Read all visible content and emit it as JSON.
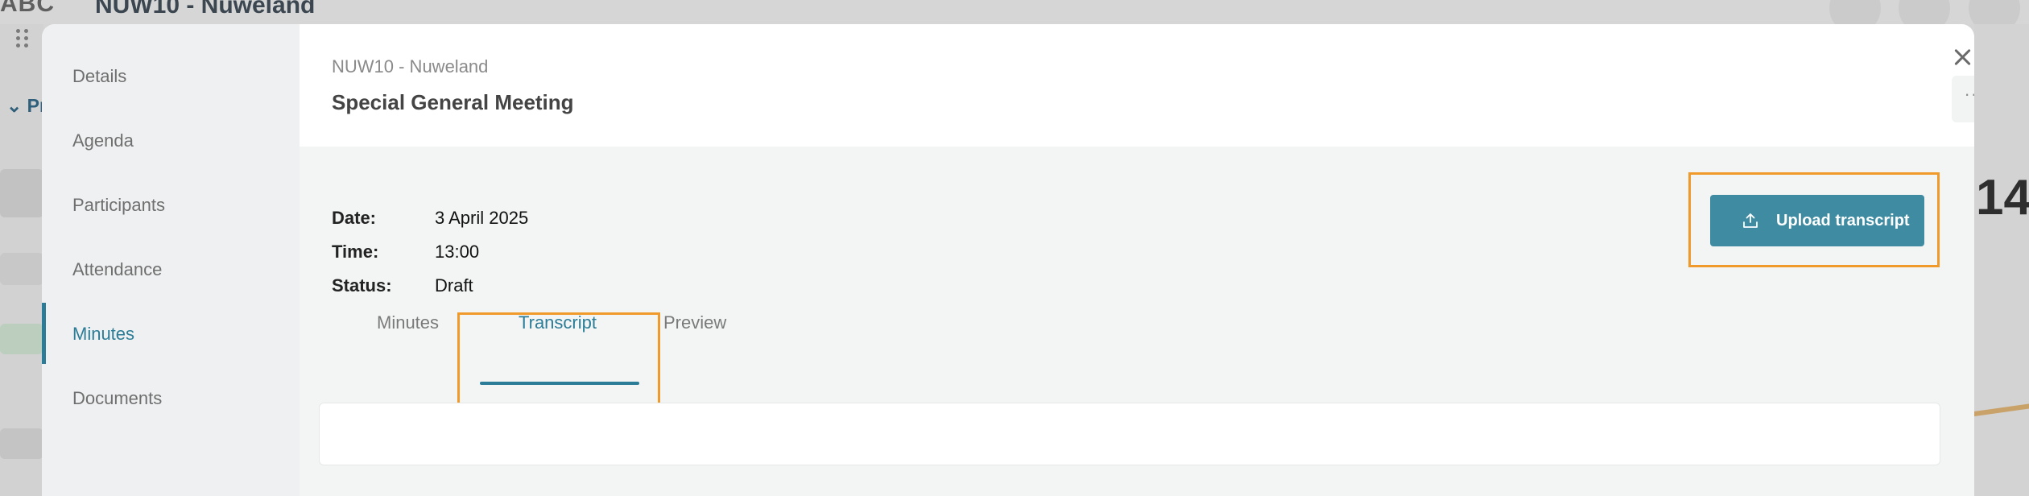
{
  "background": {
    "logo": "ABC",
    "title": "NUW10 - Nuweland",
    "section_prefix": "Pr",
    "number_fragment": "14"
  },
  "sidebar": {
    "items": [
      {
        "label": "Details"
      },
      {
        "label": "Agenda"
      },
      {
        "label": "Participants"
      },
      {
        "label": "Attendance"
      },
      {
        "label": "Minutes",
        "active": true
      },
      {
        "label": "Documents"
      }
    ]
  },
  "header": {
    "subtitle": "NUW10 - Nuweland",
    "title": "Special General Meeting",
    "more_label": "···"
  },
  "meeting": {
    "date_label": "Date:",
    "date_value": "3 April 2025",
    "time_label": "Time:",
    "time_value": "13:00",
    "status_label": "Status:",
    "status_value": "Draft"
  },
  "actions": {
    "upload_label": "Upload transcript",
    "upload_icon": "upload-icon"
  },
  "tabs": [
    {
      "label": "Minutes"
    },
    {
      "label": "Transcript",
      "active": true
    },
    {
      "label": "Preview"
    }
  ],
  "colors": {
    "accent": "#2b7d97",
    "button": "#3e8ba2",
    "highlight": "#f09a2c"
  }
}
